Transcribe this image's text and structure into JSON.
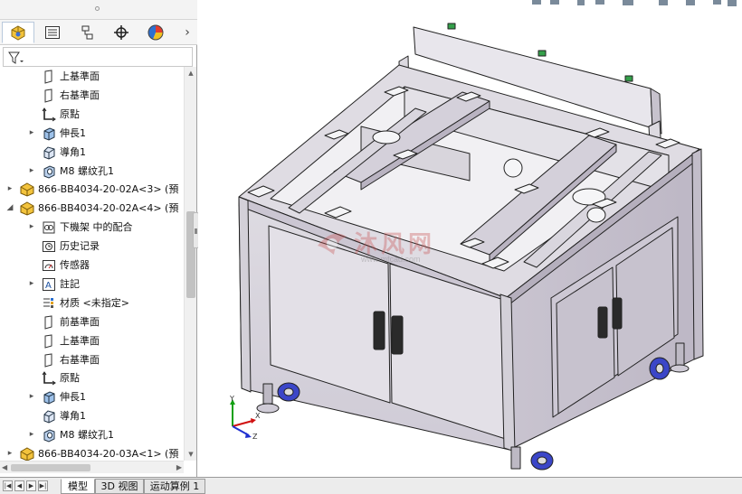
{
  "feature_tree": {
    "rows": [
      {
        "label": "上基準面",
        "icon": "plane-icon"
      },
      {
        "label": "右基準面",
        "icon": "plane-icon"
      },
      {
        "label": "原點",
        "icon": "origin-icon"
      },
      {
        "label": "伸長1",
        "icon": "extrude-icon"
      },
      {
        "label": "導角1",
        "icon": "chamfer-icon"
      },
      {
        "label": "M8 螺纹孔1",
        "icon": "hole-icon"
      },
      {
        "label": "866-BB4034-20-02A<3> (預",
        "icon": "part-icon"
      },
      {
        "label": "866-BB4034-20-02A<4> (預",
        "icon": "part-icon"
      },
      {
        "label": "下機架 中的配合",
        "icon": "mates-icon"
      },
      {
        "label": "历史记录",
        "icon": "history-icon"
      },
      {
        "label": "传感器",
        "icon": "sensor-icon"
      },
      {
        "label": "註記",
        "icon": "annotation-icon"
      },
      {
        "label": "材质 <未指定>",
        "icon": "material-icon"
      },
      {
        "label": "前基準面",
        "icon": "plane-icon"
      },
      {
        "label": "上基準面",
        "icon": "plane-icon"
      },
      {
        "label": "右基準面",
        "icon": "plane-icon"
      },
      {
        "label": "原點",
        "icon": "origin-icon"
      },
      {
        "label": "伸長1",
        "icon": "extrude-icon"
      },
      {
        "label": "導角1",
        "icon": "chamfer-icon"
      },
      {
        "label": "M8 螺纹孔1",
        "icon": "hole-icon"
      },
      {
        "label": "866-BB4034-20-03A<1> (預",
        "icon": "part-icon"
      }
    ]
  },
  "manager_tabs": [
    "feature-manager-icon",
    "property-manager-icon",
    "configuration-manager-icon",
    "dimxpert-icon",
    "display-manager-icon"
  ],
  "bottom_tabs": [
    "模型",
    "3D 视图",
    "运动算例 1"
  ],
  "watermark": {
    "title": "沐风网",
    "url": "www.mfcad.com"
  },
  "triad": {
    "x": "X",
    "y": "Y",
    "z": "Z"
  },
  "colors": {
    "cabinet": "#d9d5de",
    "cabinet_dark": "#bfbac6",
    "frame_edge": "#222222",
    "caster": "#3b46c8",
    "triad_x": "#d01010",
    "triad_y": "#10a010",
    "triad_z": "#2030d0"
  }
}
